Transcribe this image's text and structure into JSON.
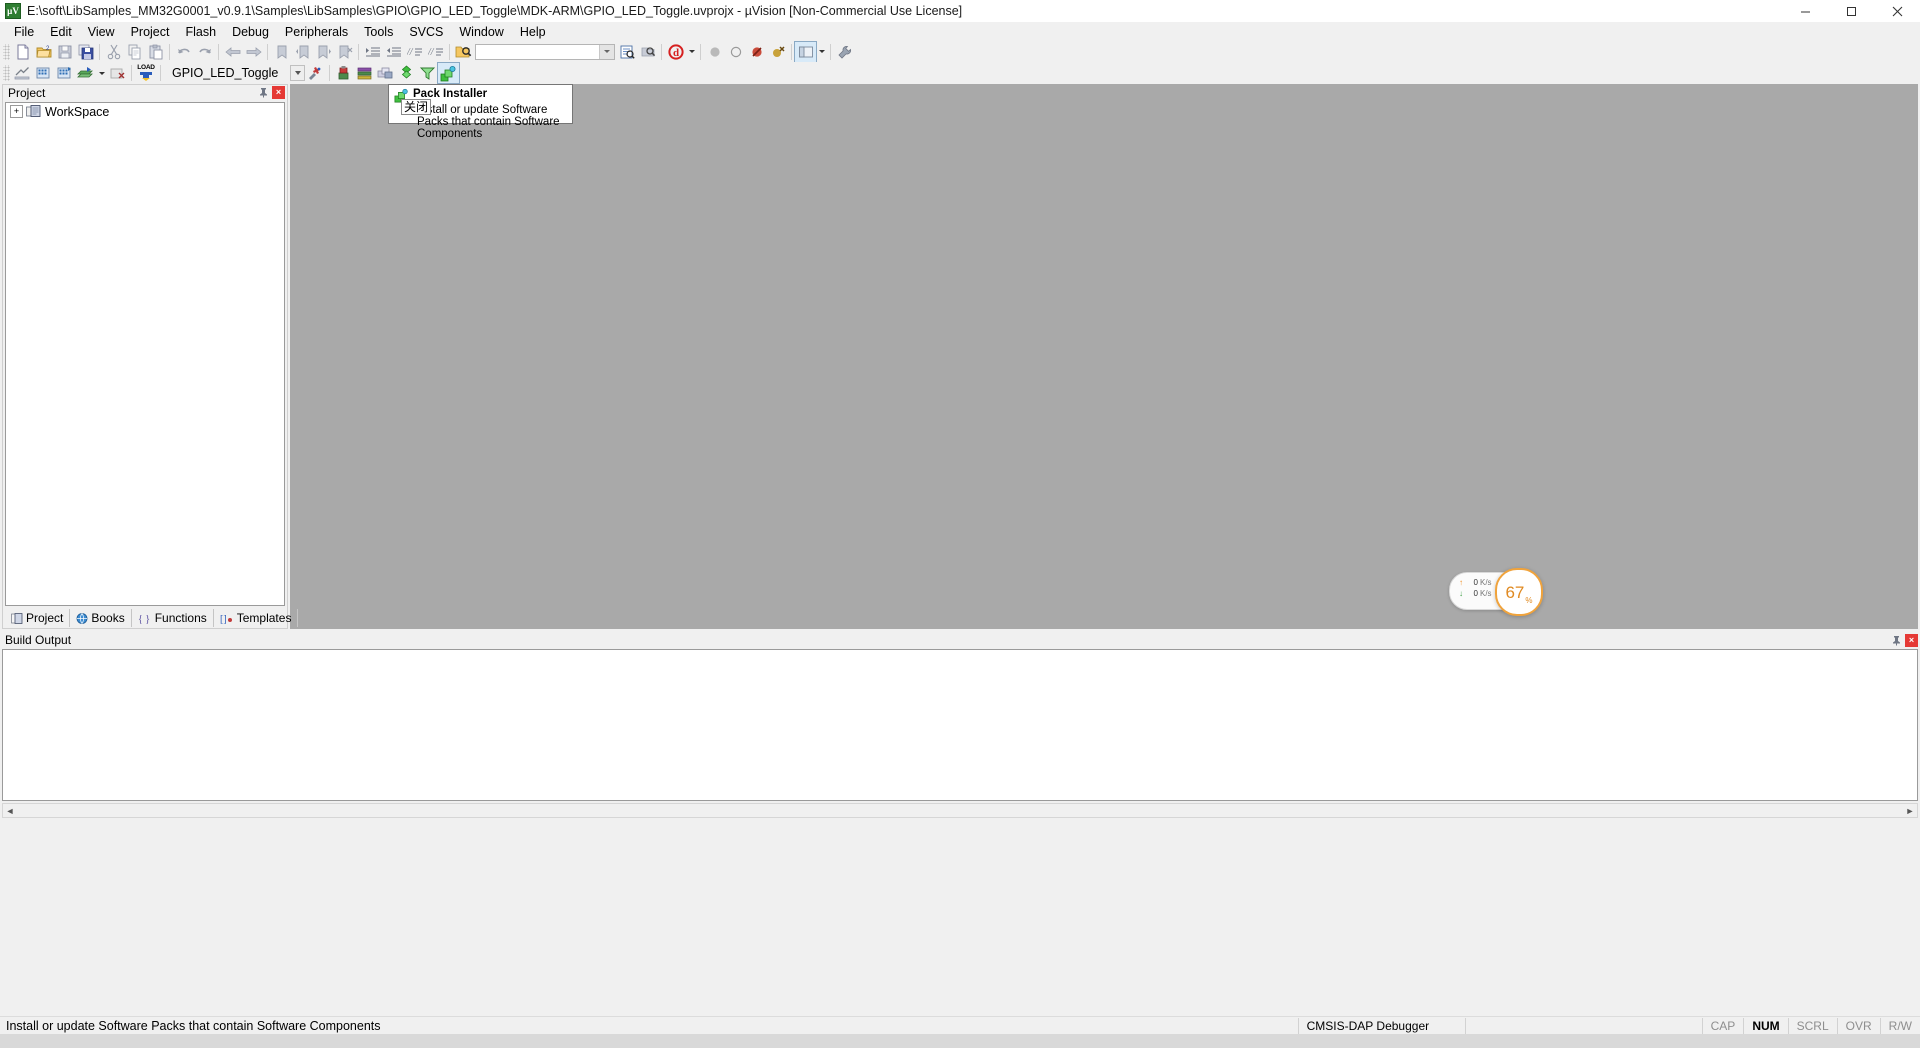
{
  "window": {
    "title": "E:\\soft\\LibSamples_MM32G0001_v0.9.1\\Samples\\LibSamples\\GPIO\\GPIO_LED_Toggle\\MDK-ARM\\GPIO_LED_Toggle.uvprojx - µVision  [Non-Commercial Use License]",
    "app_icon_text": "µV",
    "minimize_label": "Minimize",
    "maximize_label": "Maximize",
    "close_label": "Close"
  },
  "menu": {
    "items": [
      {
        "label": "File"
      },
      {
        "label": "Edit"
      },
      {
        "label": "View"
      },
      {
        "label": "Project"
      },
      {
        "label": "Flash"
      },
      {
        "label": "Debug"
      },
      {
        "label": "Peripherals"
      },
      {
        "label": "Tools"
      },
      {
        "label": "SVCS"
      },
      {
        "label": "Window"
      },
      {
        "label": "Help"
      }
    ]
  },
  "toolbar_file": {
    "buttons": [
      {
        "name": "new-file-icon",
        "tip": "New"
      },
      {
        "name": "open-file-icon",
        "tip": "Open"
      },
      {
        "name": "save-icon",
        "tip": "Save"
      },
      {
        "name": "save-all-icon",
        "tip": "Save All"
      },
      {
        "name": "cut-icon",
        "tip": "Cut"
      },
      {
        "name": "copy-icon",
        "tip": "Copy"
      },
      {
        "name": "paste-icon",
        "tip": "Paste"
      },
      {
        "name": "undo-icon",
        "tip": "Undo"
      },
      {
        "name": "redo-icon",
        "tip": "Redo"
      },
      {
        "name": "navigate-back-icon",
        "tip": "Back"
      },
      {
        "name": "navigate-forward-icon",
        "tip": "Forward"
      },
      {
        "name": "bookmark-toggle-icon",
        "tip": "Insert/Remove Bookmark"
      },
      {
        "name": "bookmark-prev-icon",
        "tip": "Previous Bookmark"
      },
      {
        "name": "bookmark-next-icon",
        "tip": "Next Bookmark"
      },
      {
        "name": "bookmark-clear-icon",
        "tip": "Clear All Bookmarks"
      },
      {
        "name": "indent-right-icon",
        "tip": "Indent"
      },
      {
        "name": "indent-left-icon",
        "tip": "Outdent"
      },
      {
        "name": "comment-icon",
        "tip": "Comment"
      },
      {
        "name": "uncomment-icon",
        "tip": "Uncomment"
      },
      {
        "name": "find-in-files-icon",
        "tip": "Find in Files"
      }
    ],
    "find": {
      "value": "",
      "placeholder": ""
    },
    "after_find": [
      {
        "name": "incremental-find-icon",
        "tip": "Incremental Find"
      },
      {
        "name": "find-next-icon",
        "tip": "Find Next"
      },
      {
        "name": "debug-start-icon",
        "tip": "Start/Stop Debug Session"
      }
    ],
    "debug_buttons": [
      {
        "name": "breakpoint-icon",
        "tip": "Insert/Remove Breakpoint"
      },
      {
        "name": "breakpoint-disable-icon",
        "tip": "Enable/Disable Breakpoint"
      },
      {
        "name": "breakpoint-disable-all-icon",
        "tip": "Disable All Breakpoints"
      },
      {
        "name": "breakpoint-kill-all-icon",
        "tip": "Kill All Breakpoints"
      }
    ],
    "window_buttons": [
      {
        "name": "window-layout-icon",
        "tip": "Window Layout"
      },
      {
        "name": "configure-tools-icon",
        "tip": "Configuration Wizard"
      }
    ]
  },
  "toolbar_build": {
    "buttons": [
      {
        "name": "translate-icon",
        "tip": "Translate current file"
      },
      {
        "name": "build-icon",
        "tip": "Build"
      },
      {
        "name": "rebuild-icon",
        "tip": "Rebuild"
      },
      {
        "name": "batch-build-icon",
        "tip": "Batch Build"
      },
      {
        "name": "stop-build-icon",
        "tip": "Stop Build"
      },
      {
        "name": "download-icon",
        "tip": "Download",
        "label": "LOAD"
      }
    ],
    "project_combo": {
      "value": "GPIO_LED_Toggle",
      "name": "target-select"
    },
    "right_buttons": [
      {
        "name": "target-options-icon",
        "tip": "Options for Target"
      },
      {
        "name": "manage-project-items-icon",
        "tip": "Manage Project Items"
      },
      {
        "name": "manage-rte-icon",
        "tip": "Manage Run-Time Environment"
      },
      {
        "name": "multi-project-icon",
        "tip": "Manage Multi-Project Workspace"
      },
      {
        "name": "pack-installer-icon",
        "tip": "Pack Installer"
      }
    ]
  },
  "tooltip": {
    "title": "Pack Installer",
    "body": "Install or update Software Packs that contain Software Components",
    "overlay_label": "关闭",
    "icon_name": "pack-installer-icon"
  },
  "project_panel": {
    "title": "Project",
    "pin_label": "Auto Hide",
    "close_label": "Close",
    "tree": [
      {
        "label": "WorkSpace",
        "expander": "+",
        "icon": "workspace-icon",
        "selected": true
      }
    ],
    "tabs": [
      {
        "label": "Project",
        "icon": "project-tab-icon",
        "active": true
      },
      {
        "label": "Books",
        "icon": "books-tab-icon",
        "active": false
      },
      {
        "label": "Functions",
        "icon": "functions-tab-icon",
        "active": false
      },
      {
        "label": "Templates",
        "icon": "templates-tab-icon",
        "active": false
      }
    ]
  },
  "build_output": {
    "title": "Build Output",
    "content": "",
    "pin_label": "Auto Hide",
    "close_label": "Close",
    "scroll_left": "◄",
    "scroll_right": "►"
  },
  "network_widget": {
    "upload_value": "0",
    "upload_unit": "K/s",
    "download_value": "0",
    "download_unit": "K/s",
    "percent": "67",
    "percent_symbol": "%",
    "up_arrow": "↑",
    "down_arrow": "↓"
  },
  "statusbar": {
    "message": "Install or update Software Packs that contain Software Components",
    "debugger": "CMSIS-DAP Debugger",
    "indicators": [
      {
        "label": "CAP",
        "active": false
      },
      {
        "label": "NUM",
        "active": true
      },
      {
        "label": "SCRL",
        "active": false
      },
      {
        "label": "OVR",
        "active": false
      },
      {
        "label": "R/W",
        "active": false
      }
    ]
  },
  "colors": {
    "accent_orange": "#e08a22",
    "close_red": "#e53935",
    "editor_gray": "#a9a9a9",
    "chrome_gray": "#f0f0f0"
  }
}
